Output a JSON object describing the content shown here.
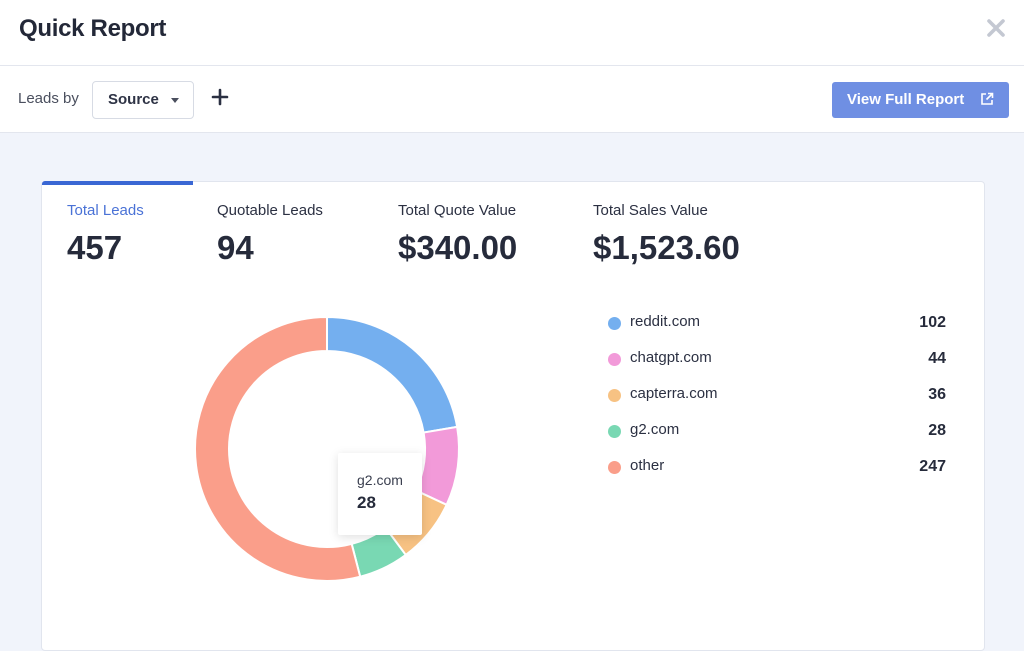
{
  "header": {
    "title": "Quick Report",
    "close_icon": "close-icon"
  },
  "toolbar": {
    "leads_by_label": "Leads by",
    "group_select": {
      "selected": "Source",
      "icon": "caret-down-icon"
    },
    "add_icon": "plus-icon",
    "full_report_label": "View Full Report",
    "full_report_icon": "external-link-icon",
    "accent": "#6f8fe3"
  },
  "stats": [
    {
      "label": "Total Leads",
      "value": "457",
      "active": true
    },
    {
      "label": "Quotable Leads",
      "value": "94",
      "active": false
    },
    {
      "label": "Total Quote Value",
      "value": "$340.00",
      "active": false
    },
    {
      "label": "Total Sales Value",
      "value": "$1,523.60",
      "active": false
    }
  ],
  "chart_data": {
    "type": "pie",
    "variant": "donut",
    "categories": [
      "reddit.com",
      "chatgpt.com",
      "capterra.com",
      "g2.com",
      "other"
    ],
    "values": [
      102,
      44,
      36,
      28,
      247
    ],
    "colors": [
      "#74afef",
      "#f29ad9",
      "#f7c283",
      "#79d8b3",
      "#fa9e8a"
    ],
    "legend": "right",
    "tooltip": {
      "label": "g2.com",
      "value": "28"
    }
  }
}
